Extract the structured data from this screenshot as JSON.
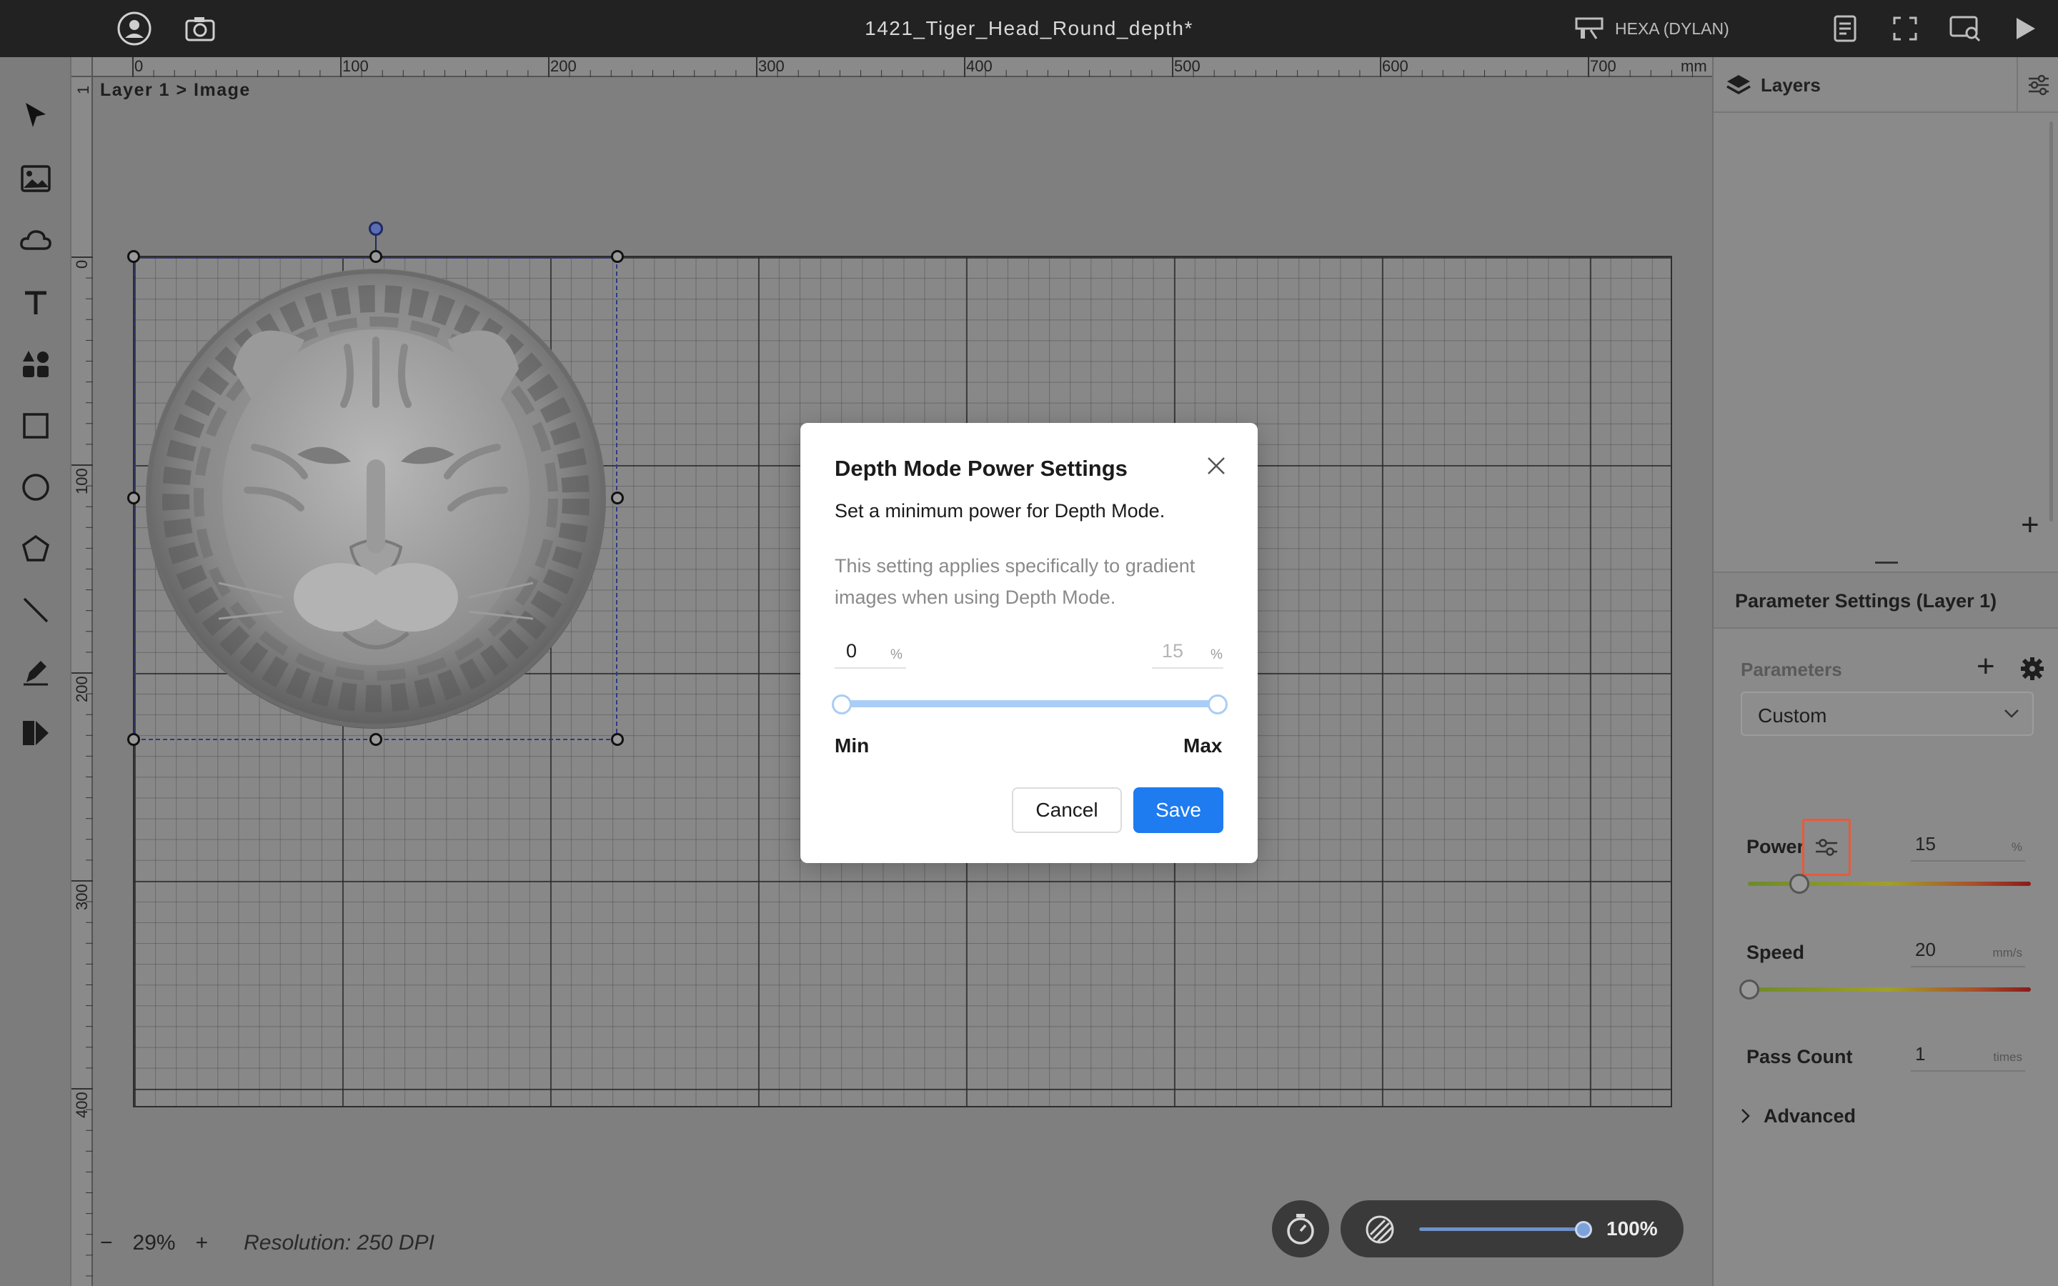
{
  "app": {
    "document_title": "1421_Tiger_Head_Round_depth*",
    "machine_name": "HEXA (DYLAN)"
  },
  "topbar": {
    "left_icons": [
      "user-icon",
      "camera-icon"
    ],
    "right_icons": [
      "document-icon",
      "fullscreen-icon",
      "preview-icon",
      "play-icon"
    ]
  },
  "toolbar": {
    "tools": [
      "select-tool-icon",
      "image-tool-icon",
      "cloud-tool-icon",
      "text-tool-icon",
      "elements-tool-icon",
      "rectangle-tool-icon",
      "ellipse-tool-icon",
      "polygon-tool-icon",
      "line-tool-icon",
      "pen-tool-icon",
      "dpp-tool-icon"
    ]
  },
  "ruler": {
    "unit": "mm",
    "top_ticks": [
      "0",
      "100",
      "200",
      "300",
      "400",
      "500",
      "600",
      "700"
    ],
    "left_ticks": [
      "0",
      "100",
      "200",
      "300",
      "400"
    ],
    "left_top_mark": "1"
  },
  "canvas": {
    "breadcrumb": "Layer 1 > Image"
  },
  "zoom": {
    "minus": "−",
    "value": "29%",
    "plus": "+",
    "resolution": "Resolution: 250 DPI"
  },
  "preview": {
    "value": "100%",
    "level": 1.0
  },
  "layers_panel": {
    "title": "Layers",
    "add": "+"
  },
  "parameter_panel": {
    "title": "Parameter Settings (Layer 1)",
    "parameters_label": "Parameters",
    "preset": "Custom",
    "power_label": "Power",
    "power_value": "15",
    "power_unit": "%",
    "power_level": 0.15,
    "speed_label": "Speed",
    "speed_value": "20",
    "speed_unit": "mm/s",
    "speed_level": 0.0,
    "pass_label": "Pass Count",
    "pass_value": "1",
    "pass_unit": "times",
    "advanced_label": "Advanced"
  },
  "modal": {
    "title": "Depth Mode Power Settings",
    "subtitle": "Set a minimum power for Depth Mode.",
    "description": "This setting applies specifically to gradient images when using Depth Mode.",
    "min_value": "0",
    "max_value": "15",
    "unit": "%",
    "min_label": "Min",
    "max_label": "Max",
    "cancel_label": "Cancel",
    "save_label": "Save"
  },
  "colors": {
    "accent": "#1e7bf0",
    "topbar": "#222222",
    "canvas": "#7f7f7f",
    "range": "#a9cdf5"
  }
}
